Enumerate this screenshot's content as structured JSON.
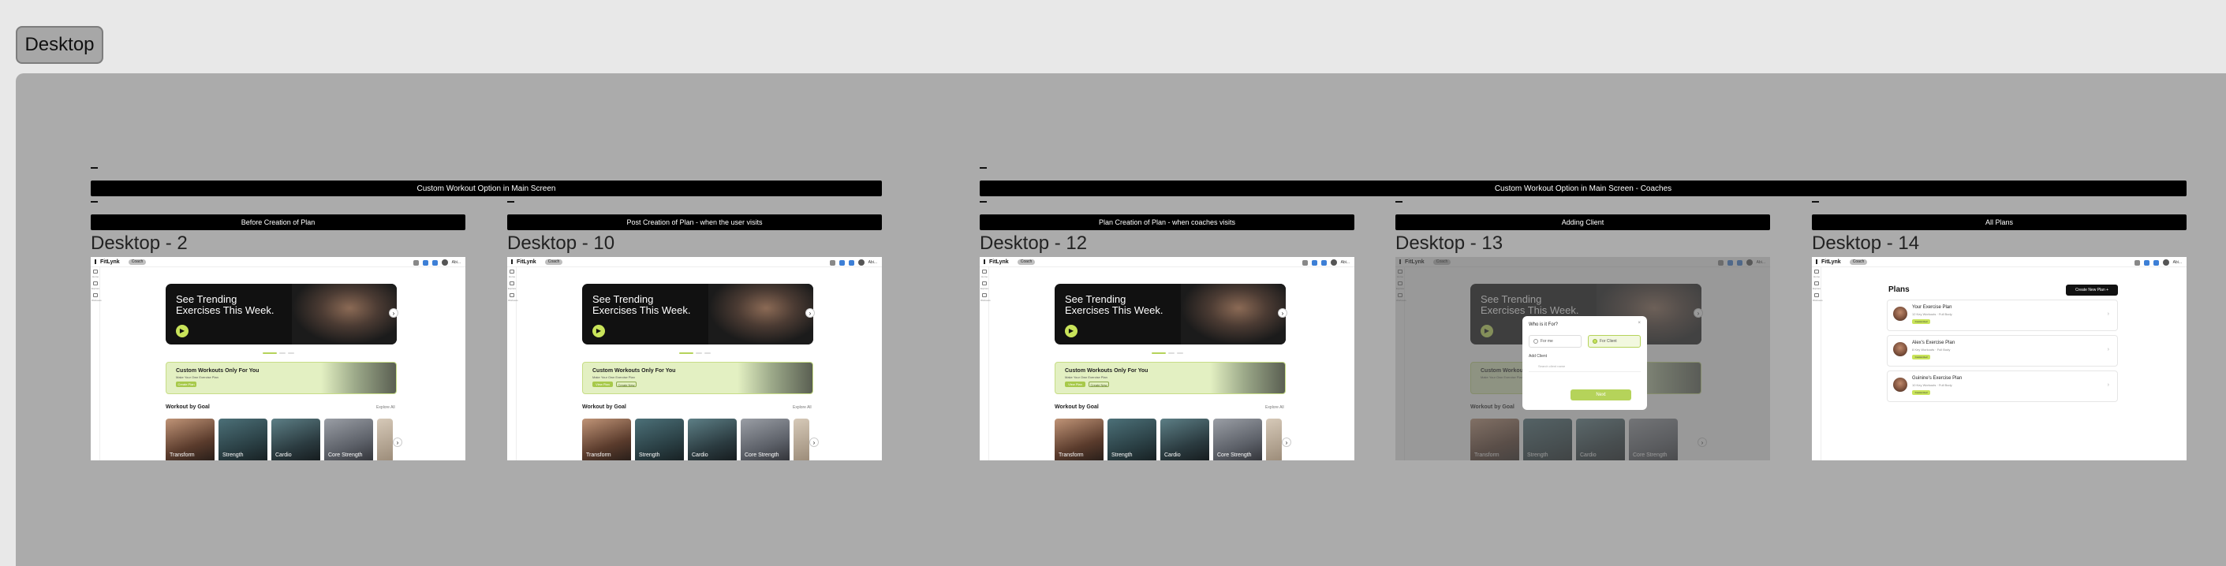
{
  "page": {
    "label": "Desktop"
  },
  "groups": [
    {
      "title": "Custom Workout Option in Main Screen"
    },
    {
      "title": "Custom Workout Option in Main Screen - Coaches"
    }
  ],
  "frames": [
    {
      "title": "Desktop - 2",
      "caption": "Before Creation of Plan"
    },
    {
      "title": "Desktop - 10",
      "caption": "Post Creation of Plan - when the user visits"
    },
    {
      "title": "Desktop - 12",
      "caption": "Plan Creation of Plan - when coaches visits"
    },
    {
      "title": "Desktop - 13",
      "caption": "Adding Client"
    },
    {
      "title": "Desktop - 14",
      "caption": "All Plans"
    }
  ],
  "app": {
    "logo": "FitLynk",
    "coach_pill": "Coach",
    "user_name": "Abi...",
    "sidebar": [
      {
        "label": "Home",
        "icon": "home-icon"
      },
      {
        "label": "Explore",
        "icon": "search-icon"
      },
      {
        "label": "Workouts",
        "icon": "dumbbell-icon"
      }
    ]
  },
  "home": {
    "hero_title": "See Trending\nExercises This Week.",
    "hero_btn": "▶",
    "hero_arrow": "›",
    "custom_title": "Custom Workouts Only For You",
    "custom_sub": "Make Your Own Exercise Plan",
    "custom_btn_before": "Create Plan",
    "custom_btn_view": "View Plan",
    "custom_btn_create": "Create New",
    "wbg_title": "Workout by Goal",
    "wbg_link": "Explore All",
    "wbg_cards": [
      "Transform",
      "Strength",
      "Cardio",
      "Core Strength"
    ],
    "wbg_arrow": "›"
  },
  "modal": {
    "title": "Who is it For?",
    "close": "×",
    "option_self": "For me",
    "option_client": "For Client",
    "label": "Add Client",
    "input_placeholder": "Search client name",
    "next": "Next"
  },
  "plans": {
    "title": "Plans",
    "create": "Create New Plan +",
    "chevron": "›",
    "items": [
      {
        "name": "Your Exercise Plan",
        "meta": "12 Key Workouts · Full Body",
        "badge": "Customized"
      },
      {
        "name": "Alex's Exercise Plan",
        "meta": "8 Key Workouts · Full Body",
        "badge": "Customized"
      },
      {
        "name": "Guinine's Exercise Plan",
        "meta": "10 Key Workouts · Full Body",
        "badge": "Customized"
      }
    ]
  },
  "colors": {
    "accent": "#c9e45a",
    "canvas": "#ababab",
    "page_bg": "#e8e8e8"
  }
}
